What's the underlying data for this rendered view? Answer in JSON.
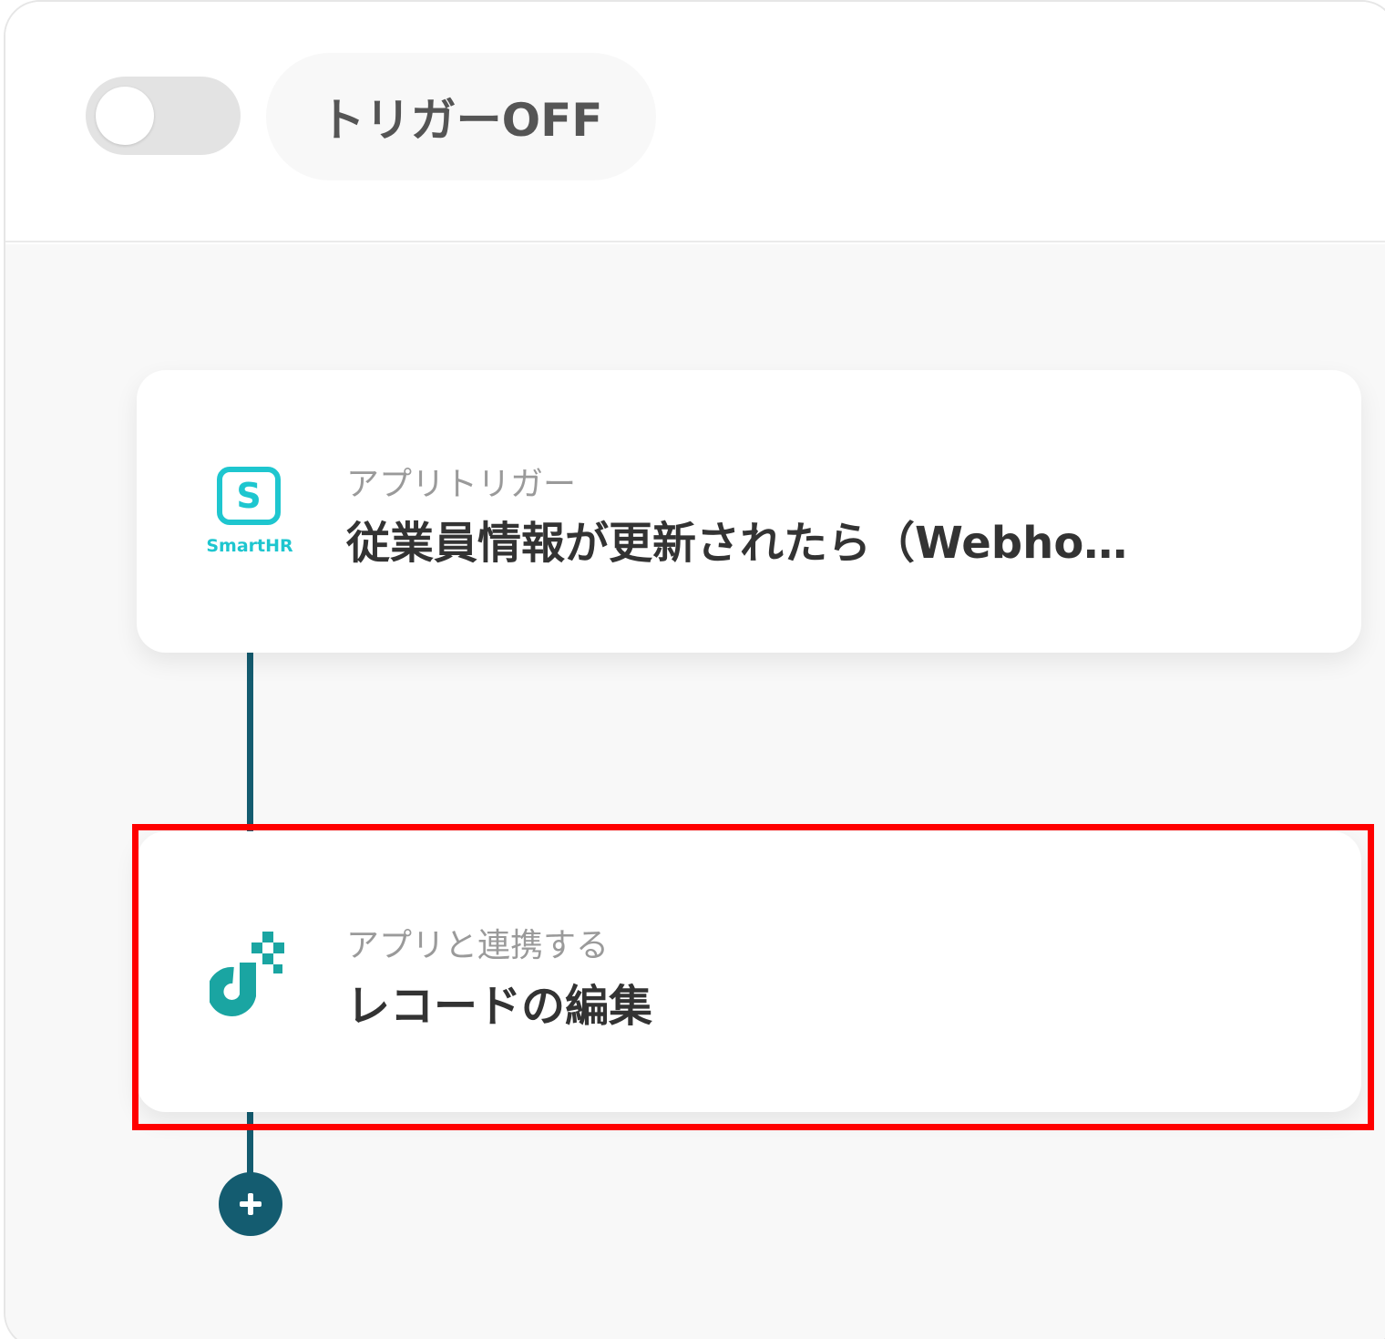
{
  "header": {
    "toggle_state": "off",
    "trigger_status_label": "トリガーOFF"
  },
  "flow": {
    "steps": [
      {
        "subtitle": "アプリトリガー",
        "title": "従業員情報が更新されたら（Webho…",
        "app_icon": "smarthr-logo",
        "app_logo_letter": "S",
        "app_logo_name": "SmartHR"
      },
      {
        "subtitle": "アプリと連携する",
        "title": "レコードの編集",
        "app_icon": "app-logo",
        "highlighted": true
      }
    ],
    "add_step_icon": "plus-icon"
  },
  "colors": {
    "accent": "#145c70",
    "smarthr": "#1ec6cf",
    "app_logo": "#1aa5a2",
    "highlight": "#ff0000",
    "toggle_off": "#e3e3e3"
  }
}
